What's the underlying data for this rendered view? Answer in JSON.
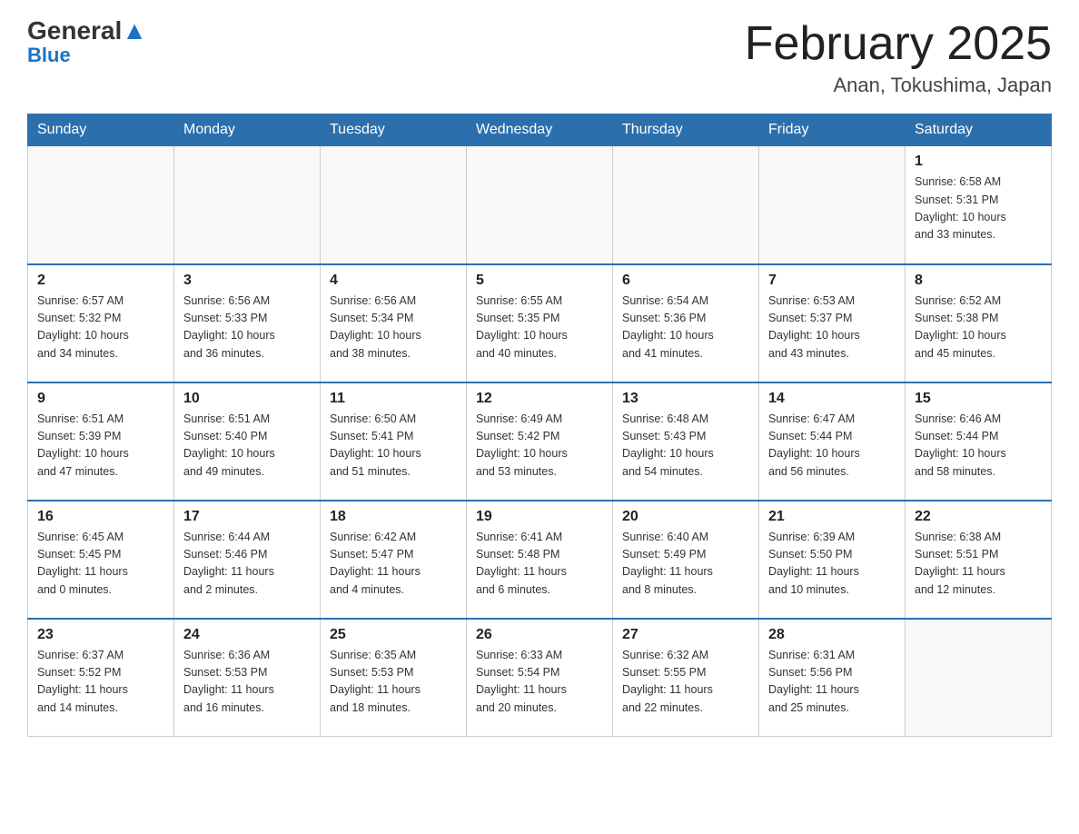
{
  "header": {
    "logo_general": "General",
    "logo_blue": "Blue",
    "title": "February 2025",
    "subtitle": "Anan, Tokushima, Japan"
  },
  "days_of_week": [
    "Sunday",
    "Monday",
    "Tuesday",
    "Wednesday",
    "Thursday",
    "Friday",
    "Saturday"
  ],
  "weeks": [
    [
      {
        "day": "",
        "info": ""
      },
      {
        "day": "",
        "info": ""
      },
      {
        "day": "",
        "info": ""
      },
      {
        "day": "",
        "info": ""
      },
      {
        "day": "",
        "info": ""
      },
      {
        "day": "",
        "info": ""
      },
      {
        "day": "1",
        "info": "Sunrise: 6:58 AM\nSunset: 5:31 PM\nDaylight: 10 hours\nand 33 minutes."
      }
    ],
    [
      {
        "day": "2",
        "info": "Sunrise: 6:57 AM\nSunset: 5:32 PM\nDaylight: 10 hours\nand 34 minutes."
      },
      {
        "day": "3",
        "info": "Sunrise: 6:56 AM\nSunset: 5:33 PM\nDaylight: 10 hours\nand 36 minutes."
      },
      {
        "day": "4",
        "info": "Sunrise: 6:56 AM\nSunset: 5:34 PM\nDaylight: 10 hours\nand 38 minutes."
      },
      {
        "day": "5",
        "info": "Sunrise: 6:55 AM\nSunset: 5:35 PM\nDaylight: 10 hours\nand 40 minutes."
      },
      {
        "day": "6",
        "info": "Sunrise: 6:54 AM\nSunset: 5:36 PM\nDaylight: 10 hours\nand 41 minutes."
      },
      {
        "day": "7",
        "info": "Sunrise: 6:53 AM\nSunset: 5:37 PM\nDaylight: 10 hours\nand 43 minutes."
      },
      {
        "day": "8",
        "info": "Sunrise: 6:52 AM\nSunset: 5:38 PM\nDaylight: 10 hours\nand 45 minutes."
      }
    ],
    [
      {
        "day": "9",
        "info": "Sunrise: 6:51 AM\nSunset: 5:39 PM\nDaylight: 10 hours\nand 47 minutes."
      },
      {
        "day": "10",
        "info": "Sunrise: 6:51 AM\nSunset: 5:40 PM\nDaylight: 10 hours\nand 49 minutes."
      },
      {
        "day": "11",
        "info": "Sunrise: 6:50 AM\nSunset: 5:41 PM\nDaylight: 10 hours\nand 51 minutes."
      },
      {
        "day": "12",
        "info": "Sunrise: 6:49 AM\nSunset: 5:42 PM\nDaylight: 10 hours\nand 53 minutes."
      },
      {
        "day": "13",
        "info": "Sunrise: 6:48 AM\nSunset: 5:43 PM\nDaylight: 10 hours\nand 54 minutes."
      },
      {
        "day": "14",
        "info": "Sunrise: 6:47 AM\nSunset: 5:44 PM\nDaylight: 10 hours\nand 56 minutes."
      },
      {
        "day": "15",
        "info": "Sunrise: 6:46 AM\nSunset: 5:44 PM\nDaylight: 10 hours\nand 58 minutes."
      }
    ],
    [
      {
        "day": "16",
        "info": "Sunrise: 6:45 AM\nSunset: 5:45 PM\nDaylight: 11 hours\nand 0 minutes."
      },
      {
        "day": "17",
        "info": "Sunrise: 6:44 AM\nSunset: 5:46 PM\nDaylight: 11 hours\nand 2 minutes."
      },
      {
        "day": "18",
        "info": "Sunrise: 6:42 AM\nSunset: 5:47 PM\nDaylight: 11 hours\nand 4 minutes."
      },
      {
        "day": "19",
        "info": "Sunrise: 6:41 AM\nSunset: 5:48 PM\nDaylight: 11 hours\nand 6 minutes."
      },
      {
        "day": "20",
        "info": "Sunrise: 6:40 AM\nSunset: 5:49 PM\nDaylight: 11 hours\nand 8 minutes."
      },
      {
        "day": "21",
        "info": "Sunrise: 6:39 AM\nSunset: 5:50 PM\nDaylight: 11 hours\nand 10 minutes."
      },
      {
        "day": "22",
        "info": "Sunrise: 6:38 AM\nSunset: 5:51 PM\nDaylight: 11 hours\nand 12 minutes."
      }
    ],
    [
      {
        "day": "23",
        "info": "Sunrise: 6:37 AM\nSunset: 5:52 PM\nDaylight: 11 hours\nand 14 minutes."
      },
      {
        "day": "24",
        "info": "Sunrise: 6:36 AM\nSunset: 5:53 PM\nDaylight: 11 hours\nand 16 minutes."
      },
      {
        "day": "25",
        "info": "Sunrise: 6:35 AM\nSunset: 5:53 PM\nDaylight: 11 hours\nand 18 minutes."
      },
      {
        "day": "26",
        "info": "Sunrise: 6:33 AM\nSunset: 5:54 PM\nDaylight: 11 hours\nand 20 minutes."
      },
      {
        "day": "27",
        "info": "Sunrise: 6:32 AM\nSunset: 5:55 PM\nDaylight: 11 hours\nand 22 minutes."
      },
      {
        "day": "28",
        "info": "Sunrise: 6:31 AM\nSunset: 5:56 PM\nDaylight: 11 hours\nand 25 minutes."
      },
      {
        "day": "",
        "info": ""
      }
    ]
  ]
}
